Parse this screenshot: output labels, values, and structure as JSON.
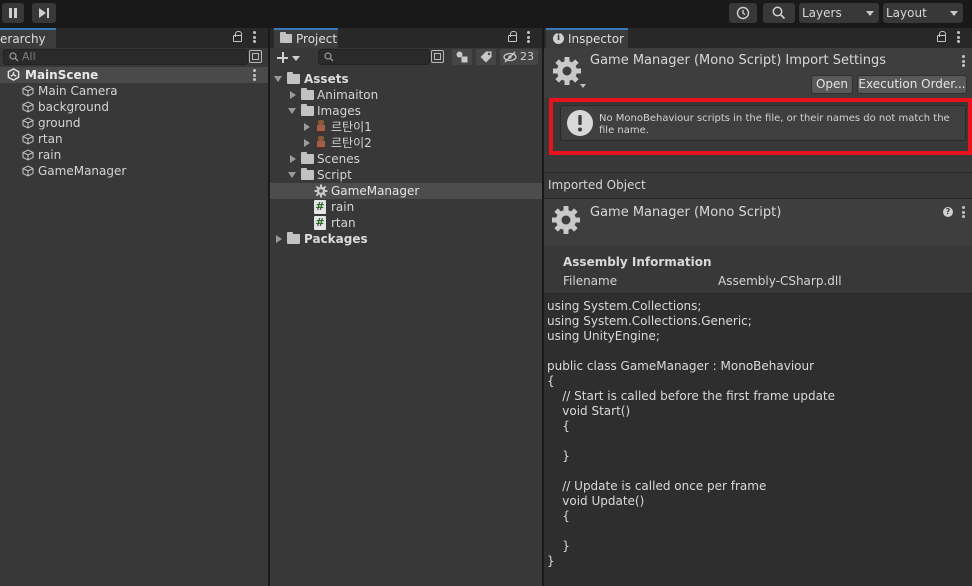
{
  "toolbar": {
    "layers_label": "Layers",
    "layout_label": "Layout"
  },
  "hierarchy": {
    "tab_label": "erarchy",
    "search_placeholder": "All",
    "scene_name": "MainScene",
    "objects": [
      "Main Camera",
      "background",
      "ground",
      "rtan",
      "rain",
      "GameManager"
    ]
  },
  "project": {
    "tab_label": "Project",
    "hidden_count": "23",
    "tree": {
      "assets": "Assets",
      "animaiton": "Animaiton",
      "images": "Images",
      "image1": "르탄이1",
      "image2": "르탄이2",
      "scenes": "Scenes",
      "script": "Script",
      "gamemanager": "GameManager",
      "rain": "rain",
      "rtan": "rtan",
      "packages": "Packages"
    }
  },
  "inspector": {
    "tab_label": "Inspector",
    "header_title": "Game Manager (Mono Script) Import Settings",
    "open_button": "Open",
    "execution_order_button": "Execution Order...",
    "warning_text": "No MonoBehaviour scripts in the file, or their names do not match the file name.",
    "imported_object_label": "Imported Object",
    "object_title": "Game Manager (Mono Script)",
    "assembly_info_label": "Assembly Information",
    "filename_label": "Filename",
    "filename_value": "Assembly-CSharp.dll",
    "code_lines": [
      "using System.Collections;",
      "using System.Collections.Generic;",
      "using UnityEngine;",
      "",
      "public class GameManager : MonoBehaviour",
      "{",
      "    // Start is called before the first frame update",
      "    void Start()",
      "    {",
      "",
      "    }",
      "",
      "    // Update is called once per frame",
      "    void Update()",
      "    {",
      "",
      "    }",
      "}"
    ]
  },
  "colors": {
    "highlight_border": "#e8121c",
    "accent": "#3a79bb",
    "selected_row": "#4d4d4d"
  }
}
